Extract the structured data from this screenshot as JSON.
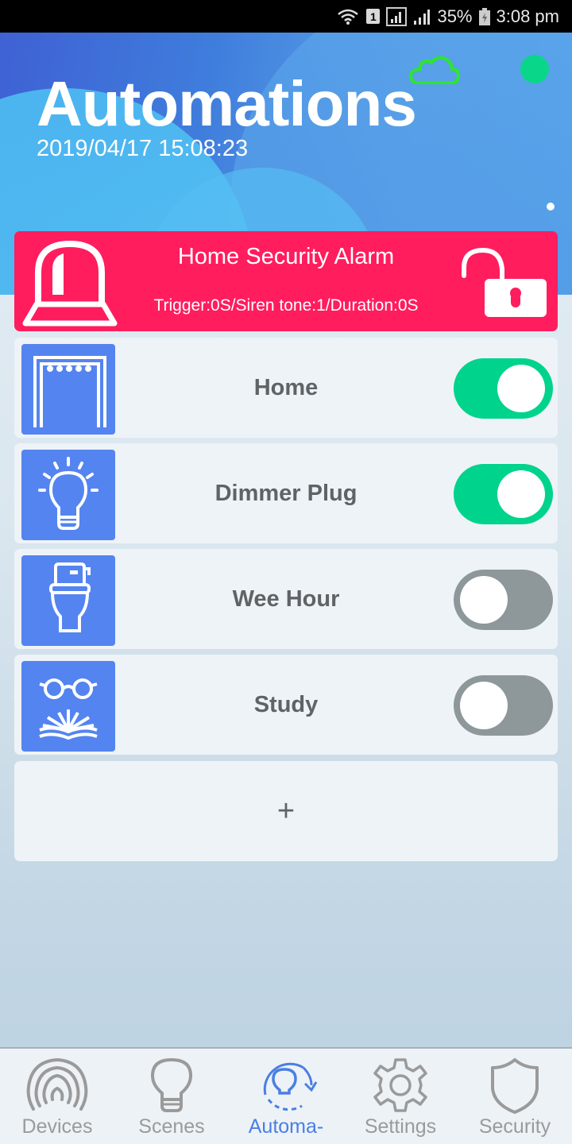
{
  "status_bar": {
    "battery": "35%",
    "time": "3:08 pm",
    "sim_slot": "1"
  },
  "header": {
    "title": "Automations",
    "datetime": "2019/04/17 15:08:23",
    "cloud_status_color": "#2ce62c",
    "online_indicator_color": "#0ad68a"
  },
  "alarm": {
    "title": "Home Security Alarm",
    "subtitle": "Trigger:0S/Siren tone:1/Duration:0S",
    "lock_state": "unlocked",
    "color": "#ff1d5e"
  },
  "automations": [
    {
      "label": "Home",
      "icon": "door-curtain-icon",
      "enabled": true
    },
    {
      "label": "Dimmer Plug",
      "icon": "lightbulb-icon",
      "enabled": true
    },
    {
      "label": "Wee Hour",
      "icon": "toilet-icon",
      "enabled": false
    },
    {
      "label": "Study",
      "icon": "glasses-book-icon",
      "enabled": false
    }
  ],
  "add_button": {
    "label": "+"
  },
  "tabs": [
    {
      "label": "Devices",
      "icon": "devices-icon",
      "active": false
    },
    {
      "label": "Scenes",
      "icon": "scenes-bulb-icon",
      "active": false
    },
    {
      "label": "Automa-",
      "icon": "automation-icon",
      "active": true
    },
    {
      "label": "Settings",
      "icon": "gear-icon",
      "active": false
    },
    {
      "label": "Security",
      "icon": "shield-icon",
      "active": false
    }
  ],
  "colors": {
    "accent": "#4a7ee4",
    "toggle_on": "#00d38b",
    "toggle_off": "#8e979a",
    "tile": "#5484f0"
  }
}
